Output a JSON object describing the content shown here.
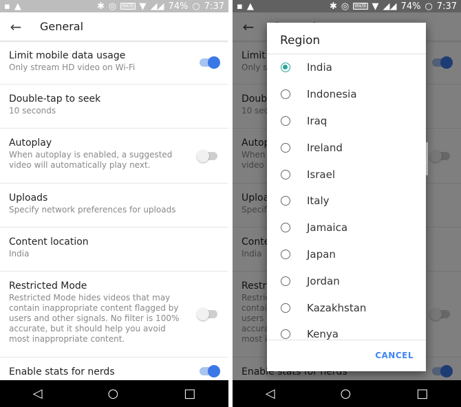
{
  "status": {
    "battery": "74%",
    "time": "7:37",
    "lte": "VoLTE"
  },
  "header": {
    "title": "General"
  },
  "settings": [
    {
      "title": "Limit mobile data usage",
      "sub": "Only stream HD video on Wi-Fi",
      "toggle": "on"
    },
    {
      "title": "Double-tap to seek",
      "sub": "10 seconds"
    },
    {
      "title": "Autoplay",
      "sub": "When autoplay is enabled, a suggested video will automatically play next.",
      "toggle": "off"
    },
    {
      "title": "Uploads",
      "sub": "Specify network preferences for uploads"
    },
    {
      "title": "Content location",
      "sub": "India"
    },
    {
      "title": "Restricted Mode",
      "sub": "Restricted Mode hides videos that may contain inappropriate content flagged by users and other signals. No filter is 100% accurate, but it should help you avoid most inappropriate content.",
      "toggle": "off"
    },
    {
      "title": "Enable stats for nerds",
      "sub": "",
      "toggle": "on"
    }
  ],
  "dialog": {
    "title": "Region",
    "selected": "India",
    "options": [
      "India",
      "Indonesia",
      "Iraq",
      "Ireland",
      "Israel",
      "Italy",
      "Jamaica",
      "Japan",
      "Jordan",
      "Kazakhstan",
      "Kenya"
    ],
    "cancel": "CANCEL"
  },
  "colors": {
    "accent": "#3b78e7",
    "radio": "#26a69a",
    "cancel": "#4285f4"
  }
}
